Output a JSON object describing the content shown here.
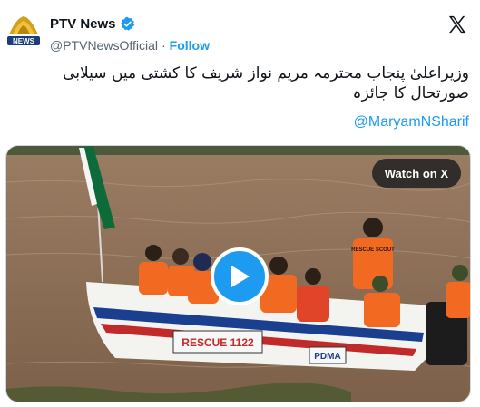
{
  "account": {
    "display_name": "PTV News",
    "handle": "@PTVNewsOfficial",
    "separator": "·",
    "follow_label": "Follow",
    "avatar_text": "NEWS"
  },
  "tweet": {
    "text": "وزیراعلیٰ پنجاب محترمہ مریم نواز شریف کا کشتی میں سیلابی صورتحال کا جائزہ",
    "mention": "@MaryamNSharif"
  },
  "media": {
    "watch_label": "Watch on X",
    "boat_label": "RESCUE 1122",
    "boat_label2": "PDMA",
    "vest_text": "RESCUE SCOUT"
  },
  "colors": {
    "accent": "#1d9bf0",
    "water": "#8a6e57",
    "vest": "#f26a21"
  }
}
